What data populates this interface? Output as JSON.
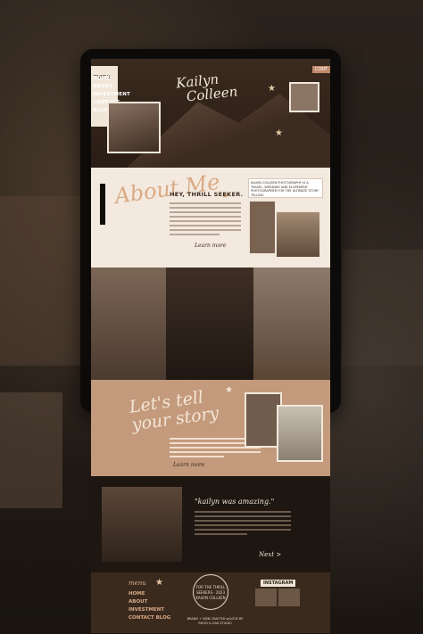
{
  "menu": {
    "title": "menu",
    "items": [
      "HOME",
      "ABOUT",
      "INVESTMENT",
      "CONTACT",
      "BLOG"
    ],
    "contact_tab": "CONT"
  },
  "hero": {
    "name_line1": "Kailyn",
    "name_line2": "Colleen"
  },
  "about": {
    "script": "About Me",
    "heading": "HEY, THRILL SEEKER.",
    "learn": "Learn more",
    "card": "KAILYN COLLEEN PHOTOGRAPHY IS A TRAVEL, WEDDING AND ELOPEMENT PHOTOGRAPHER FOR THE ULTIMATE STORY TELLING"
  },
  "story": {
    "script_line1": "Let's tell",
    "script_line2": "your story",
    "learn": "Learn more"
  },
  "testimonial": {
    "quote": "\"kailyn was amazing.\"",
    "next": "Next >"
  },
  "footer": {
    "menu_title": "menu",
    "items": [
      "HOME",
      "ABOUT",
      "INVESTMENT",
      "CONTACT BLOG"
    ],
    "badge": "FOR THE THRILL SEEKERS · 2023 KAILYN COLLEEN",
    "brand": "BRAND + WEB CRAFTED w/LOVE BY RHOD & OAK STUDIO",
    "insta": "INSTAGRAM"
  },
  "colors": {
    "accent": "#d9aa86",
    "bg_light": "#f4e9de",
    "bg_dark": "#1d1611",
    "story": "#c49a7c"
  }
}
